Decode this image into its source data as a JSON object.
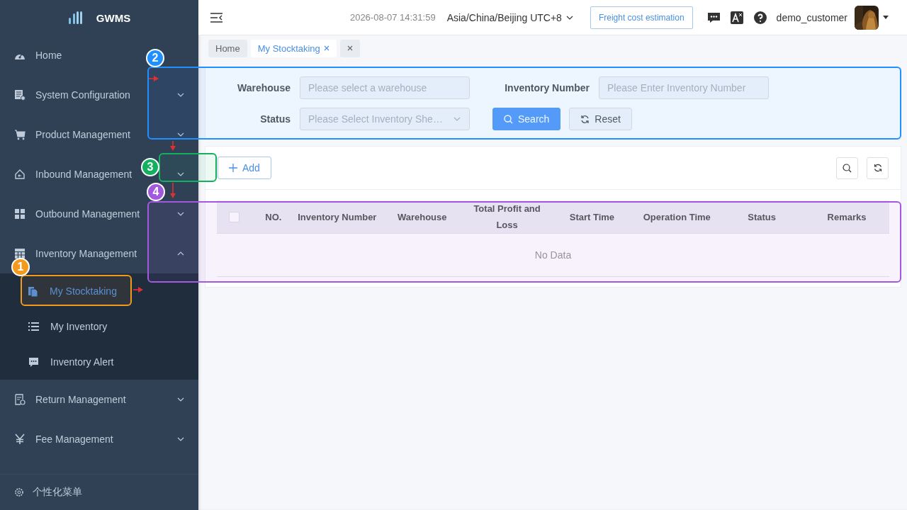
{
  "sidebar": {
    "logo": "GWMS",
    "items": [
      {
        "label": "Home",
        "kind": "link"
      },
      {
        "label": "System Configuration",
        "kind": "group",
        "expanded": false
      },
      {
        "label": "Product Management",
        "kind": "group",
        "expanded": false
      },
      {
        "label": "Inbound Management",
        "kind": "group",
        "expanded": false
      },
      {
        "label": "Outbound Management",
        "kind": "group",
        "expanded": false
      },
      {
        "label": "Inventory Management",
        "kind": "group",
        "expanded": true,
        "children": [
          {
            "label": "My Stocktaking",
            "selected": true
          },
          {
            "label": "My Inventory",
            "selected": false
          },
          {
            "label": "Inventory Alert",
            "selected": false
          }
        ]
      },
      {
        "label": "Return Management",
        "kind": "group",
        "expanded": false
      },
      {
        "label": "Fee Management",
        "kind": "group",
        "expanded": false
      }
    ],
    "footer": "个性化菜单"
  },
  "header": {
    "datetime": "2026-08-07 14:31:59",
    "timezone": "Asia/China/Beijing UTC+8",
    "freight_button": "Freight cost estimation",
    "username": "demo_customer"
  },
  "tabs": [
    {
      "label": "Home",
      "selected": false,
      "closable": false
    },
    {
      "label": "My Stocktaking",
      "selected": true,
      "closable": true
    }
  ],
  "filters": [
    {
      "label": "Warehouse",
      "placeholder": "Please select a warehouse",
      "kind": "input"
    },
    {
      "label": "Inventory Number",
      "placeholder": "Please Enter Inventory Number",
      "kind": "input"
    },
    {
      "label": "Status",
      "placeholder": "Please Select Inventory She…",
      "kind": "select"
    }
  ],
  "search_button": "Search",
  "reset_button": "Reset",
  "add_button": "Add",
  "table": {
    "select_all": {
      "checked": false
    },
    "columns": [
      "NO.",
      "Inventory Number",
      "Warehouse",
      "Total Profit and Loss",
      "Start Time",
      "Operation Time",
      "Status",
      "Remarks"
    ],
    "empty_text": "No Data"
  },
  "annotations": [
    {
      "number": "1",
      "color": "#f39a1e"
    },
    {
      "number": "2",
      "color": "#1e90ff"
    },
    {
      "number": "3",
      "color": "#14b060"
    },
    {
      "number": "4",
      "color": "#a259e0"
    }
  ]
}
